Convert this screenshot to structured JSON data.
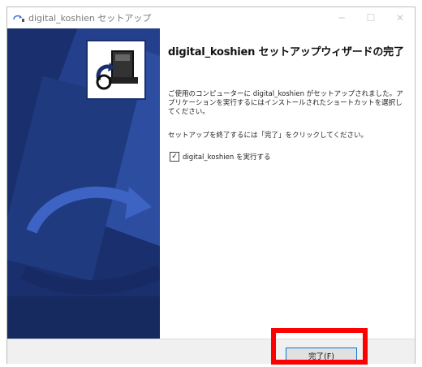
{
  "window": {
    "title": "digital_koshien セットアップ",
    "app_icon": "installer-icon",
    "controls": {
      "minimize": "─",
      "maximize": "☐",
      "close": "✕"
    }
  },
  "wizard": {
    "heading": "digital_koshien セットアップウィザードの完了",
    "paragraph1": "ご使用のコンピューターに digital_koshien がセットアップされました。アプリケーションを実行するにはインストールされたショートカットを選択してください。",
    "paragraph2": "セットアップを終了するには「完了」をクリックしてください。",
    "run_checkbox": {
      "label": "digital_koshien を実行する",
      "checked": true,
      "mark": "✓"
    }
  },
  "footer": {
    "finish_label": "完了(F)"
  },
  "colors": {
    "left_panel": "#1a2f6e",
    "highlight": "#ff0000",
    "button_focus": "#0078d7"
  }
}
